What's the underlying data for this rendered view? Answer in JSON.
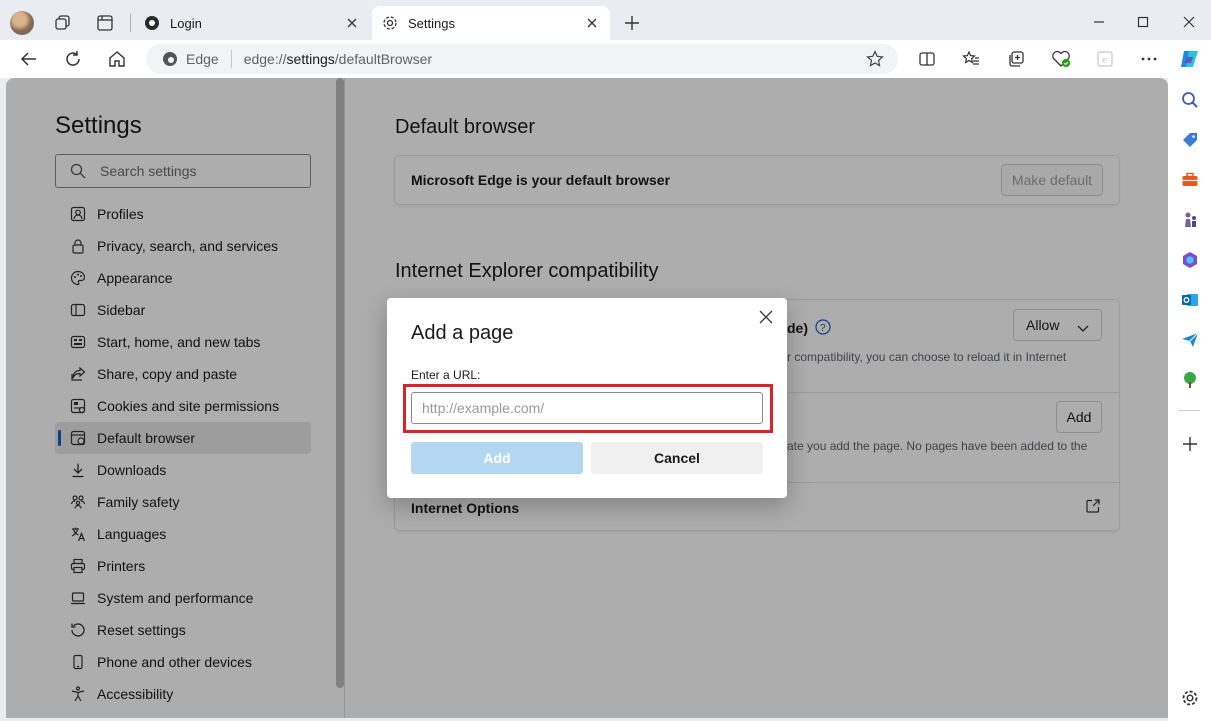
{
  "tabs": [
    {
      "title": "Login",
      "active": false
    },
    {
      "title": "Settings",
      "active": true
    }
  ],
  "omnibox": {
    "brand": "Edge",
    "url_prefix": "edge://",
    "url_host": "settings",
    "url_path": "/defaultBrowser"
  },
  "sidebar": {
    "title": "Settings",
    "search_placeholder": "Search settings",
    "items": [
      {
        "label": "Profiles",
        "icon": "profile-icon"
      },
      {
        "label": "Privacy, search, and services",
        "icon": "lock-icon"
      },
      {
        "label": "Appearance",
        "icon": "palette-icon"
      },
      {
        "label": "Sidebar",
        "icon": "sidebar-icon"
      },
      {
        "label": "Start, home, and new tabs",
        "icon": "home-tabs-icon"
      },
      {
        "label": "Share, copy and paste",
        "icon": "share-icon"
      },
      {
        "label": "Cookies and site permissions",
        "icon": "cookies-icon"
      },
      {
        "label": "Default browser",
        "icon": "default-browser-icon",
        "active": true
      },
      {
        "label": "Downloads",
        "icon": "download-icon"
      },
      {
        "label": "Family safety",
        "icon": "family-icon"
      },
      {
        "label": "Languages",
        "icon": "languages-icon"
      },
      {
        "label": "Printers",
        "icon": "printer-icon"
      },
      {
        "label": "System and performance",
        "icon": "laptop-icon"
      },
      {
        "label": "Reset settings",
        "icon": "reset-icon"
      },
      {
        "label": "Phone and other devices",
        "icon": "phone-icon"
      },
      {
        "label": "Accessibility",
        "icon": "accessibility-icon"
      }
    ]
  },
  "content": {
    "default_browser": {
      "heading": "Default browser",
      "status": "Microsoft Edge is your default browser",
      "button": "Make default"
    },
    "ie_compat": {
      "heading": "Internet Explorer compatibility",
      "row1_title_tail": "de)",
      "row1_sub": "r compatibility, you can choose to reload it in Internet",
      "row1_select": "Allow",
      "row2_button": "Add",
      "row2_sub": "ate you add the page. No pages have been added to the",
      "row3_title": "Internet Options"
    }
  },
  "dialog": {
    "title": "Add a page",
    "label": "Enter a URL:",
    "placeholder": "http://example.com/",
    "add": "Add",
    "cancel": "Cancel"
  },
  "colors": {
    "accent": "#1560bd",
    "highlight": "#d9232d",
    "add_disabled": "#b3d7f0"
  }
}
